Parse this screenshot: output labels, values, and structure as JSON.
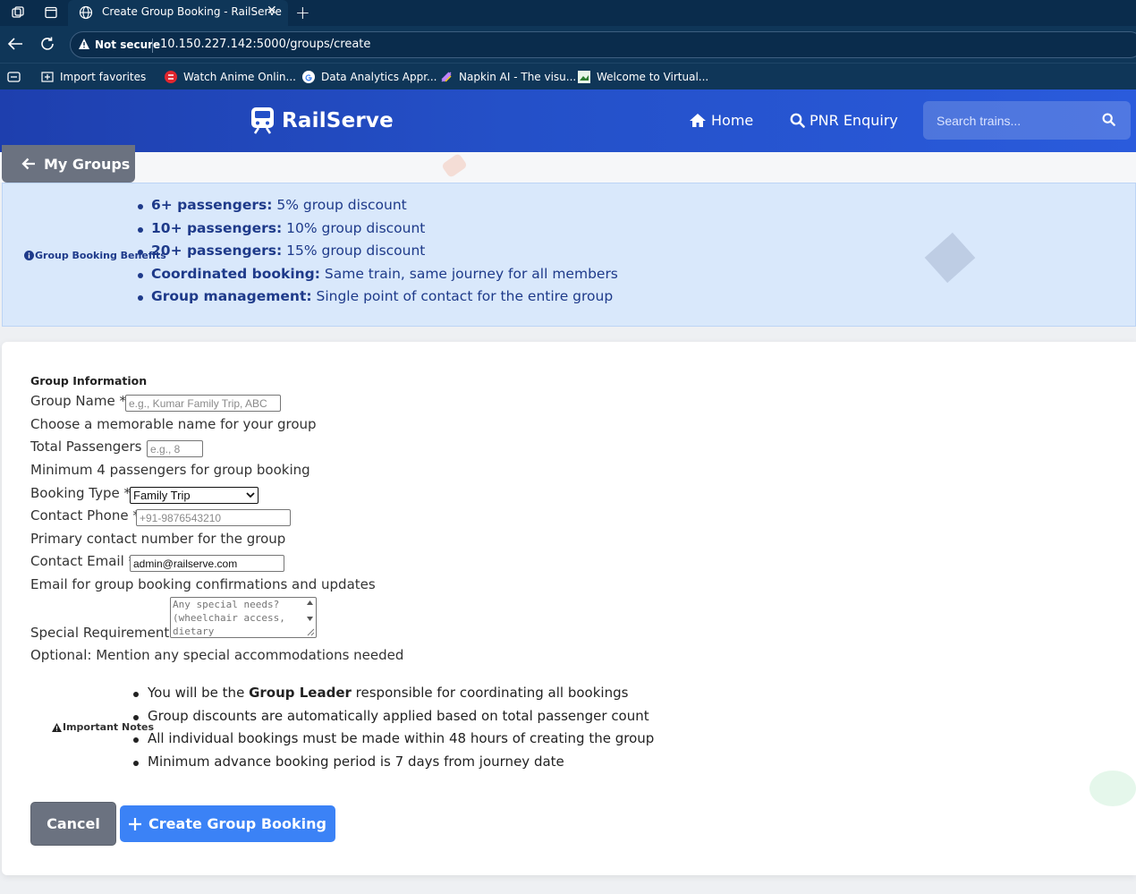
{
  "browser": {
    "tab_title": "Create Group Booking - RailServe",
    "security_label": "Not secure",
    "url": "10.150.227.142:5000/groups/create",
    "favorites": [
      "Import favorites",
      "Watch Anime Onlin...",
      "Data Analytics Appr...",
      "Napkin AI - The visu...",
      "Welcome to Virtual..."
    ]
  },
  "header": {
    "brand": "RailServe",
    "nav": [
      "Home",
      "PNR Enquiry"
    ],
    "search_placeholder": "Search trains..."
  },
  "back_button": "My Groups",
  "benefits": {
    "label": "Group Booking Benefits",
    "items": [
      {
        "bold": "6+ passengers:",
        "text": " 5% group discount"
      },
      {
        "bold": "10+ passengers:",
        "text": " 10% group discount"
      },
      {
        "bold": "20+ passengers:",
        "text": " 15% group discount"
      },
      {
        "bold": "Coordinated booking:",
        "text": " Same train, same journey for all members"
      },
      {
        "bold": "Group management:",
        "text": " Single point of contact for the entire group"
      }
    ]
  },
  "form": {
    "section_title": "Group Information",
    "group_name": {
      "label": "Group Name *",
      "placeholder": "e.g., Kumar Family Trip, ABC",
      "value": "",
      "help": "Choose a memorable name for your group"
    },
    "total_passengers": {
      "label": "Total Passengers *",
      "placeholder": "e.g., 8",
      "value": "",
      "help": "Minimum 4 passengers for group booking"
    },
    "booking_type": {
      "label": "Booking Type *",
      "value": "Family Trip"
    },
    "contact_phone": {
      "label": "Contact Phone *",
      "placeholder": "+91-9876543210",
      "value": "",
      "help": "Primary contact number for the group"
    },
    "contact_email": {
      "label": "Contact Email *",
      "value": "admin@railserve.com",
      "help": "Email for group booking confirmations and updates"
    },
    "special_requirements": {
      "label": "Special Requirements",
      "placeholder": "Any special needs? (wheelchair access, dietary",
      "help": "Optional: Mention any special accommodations needed"
    }
  },
  "notes": {
    "label": "Important Notes",
    "items": [
      {
        "pre": "You will be the ",
        "bold": "Group Leader",
        "post": " responsible for coordinating all bookings"
      },
      {
        "pre": "Group discounts are automatically applied based on total passenger count",
        "bold": "",
        "post": ""
      },
      {
        "pre": "All individual bookings must be made within 48 hours of creating the group",
        "bold": "",
        "post": ""
      },
      {
        "pre": "Minimum advance booking period is 7 days from journey date",
        "bold": "",
        "post": ""
      }
    ]
  },
  "buttons": {
    "cancel": "Cancel",
    "create": "Create Group Booking"
  },
  "colors": {
    "header_start": "#1e3fae",
    "header_end": "#2a5bdc",
    "primary": "#3b82f6",
    "secondary": "#6b7280",
    "info_bg": "#d9e8fb",
    "info_text": "#1e3a8a"
  }
}
